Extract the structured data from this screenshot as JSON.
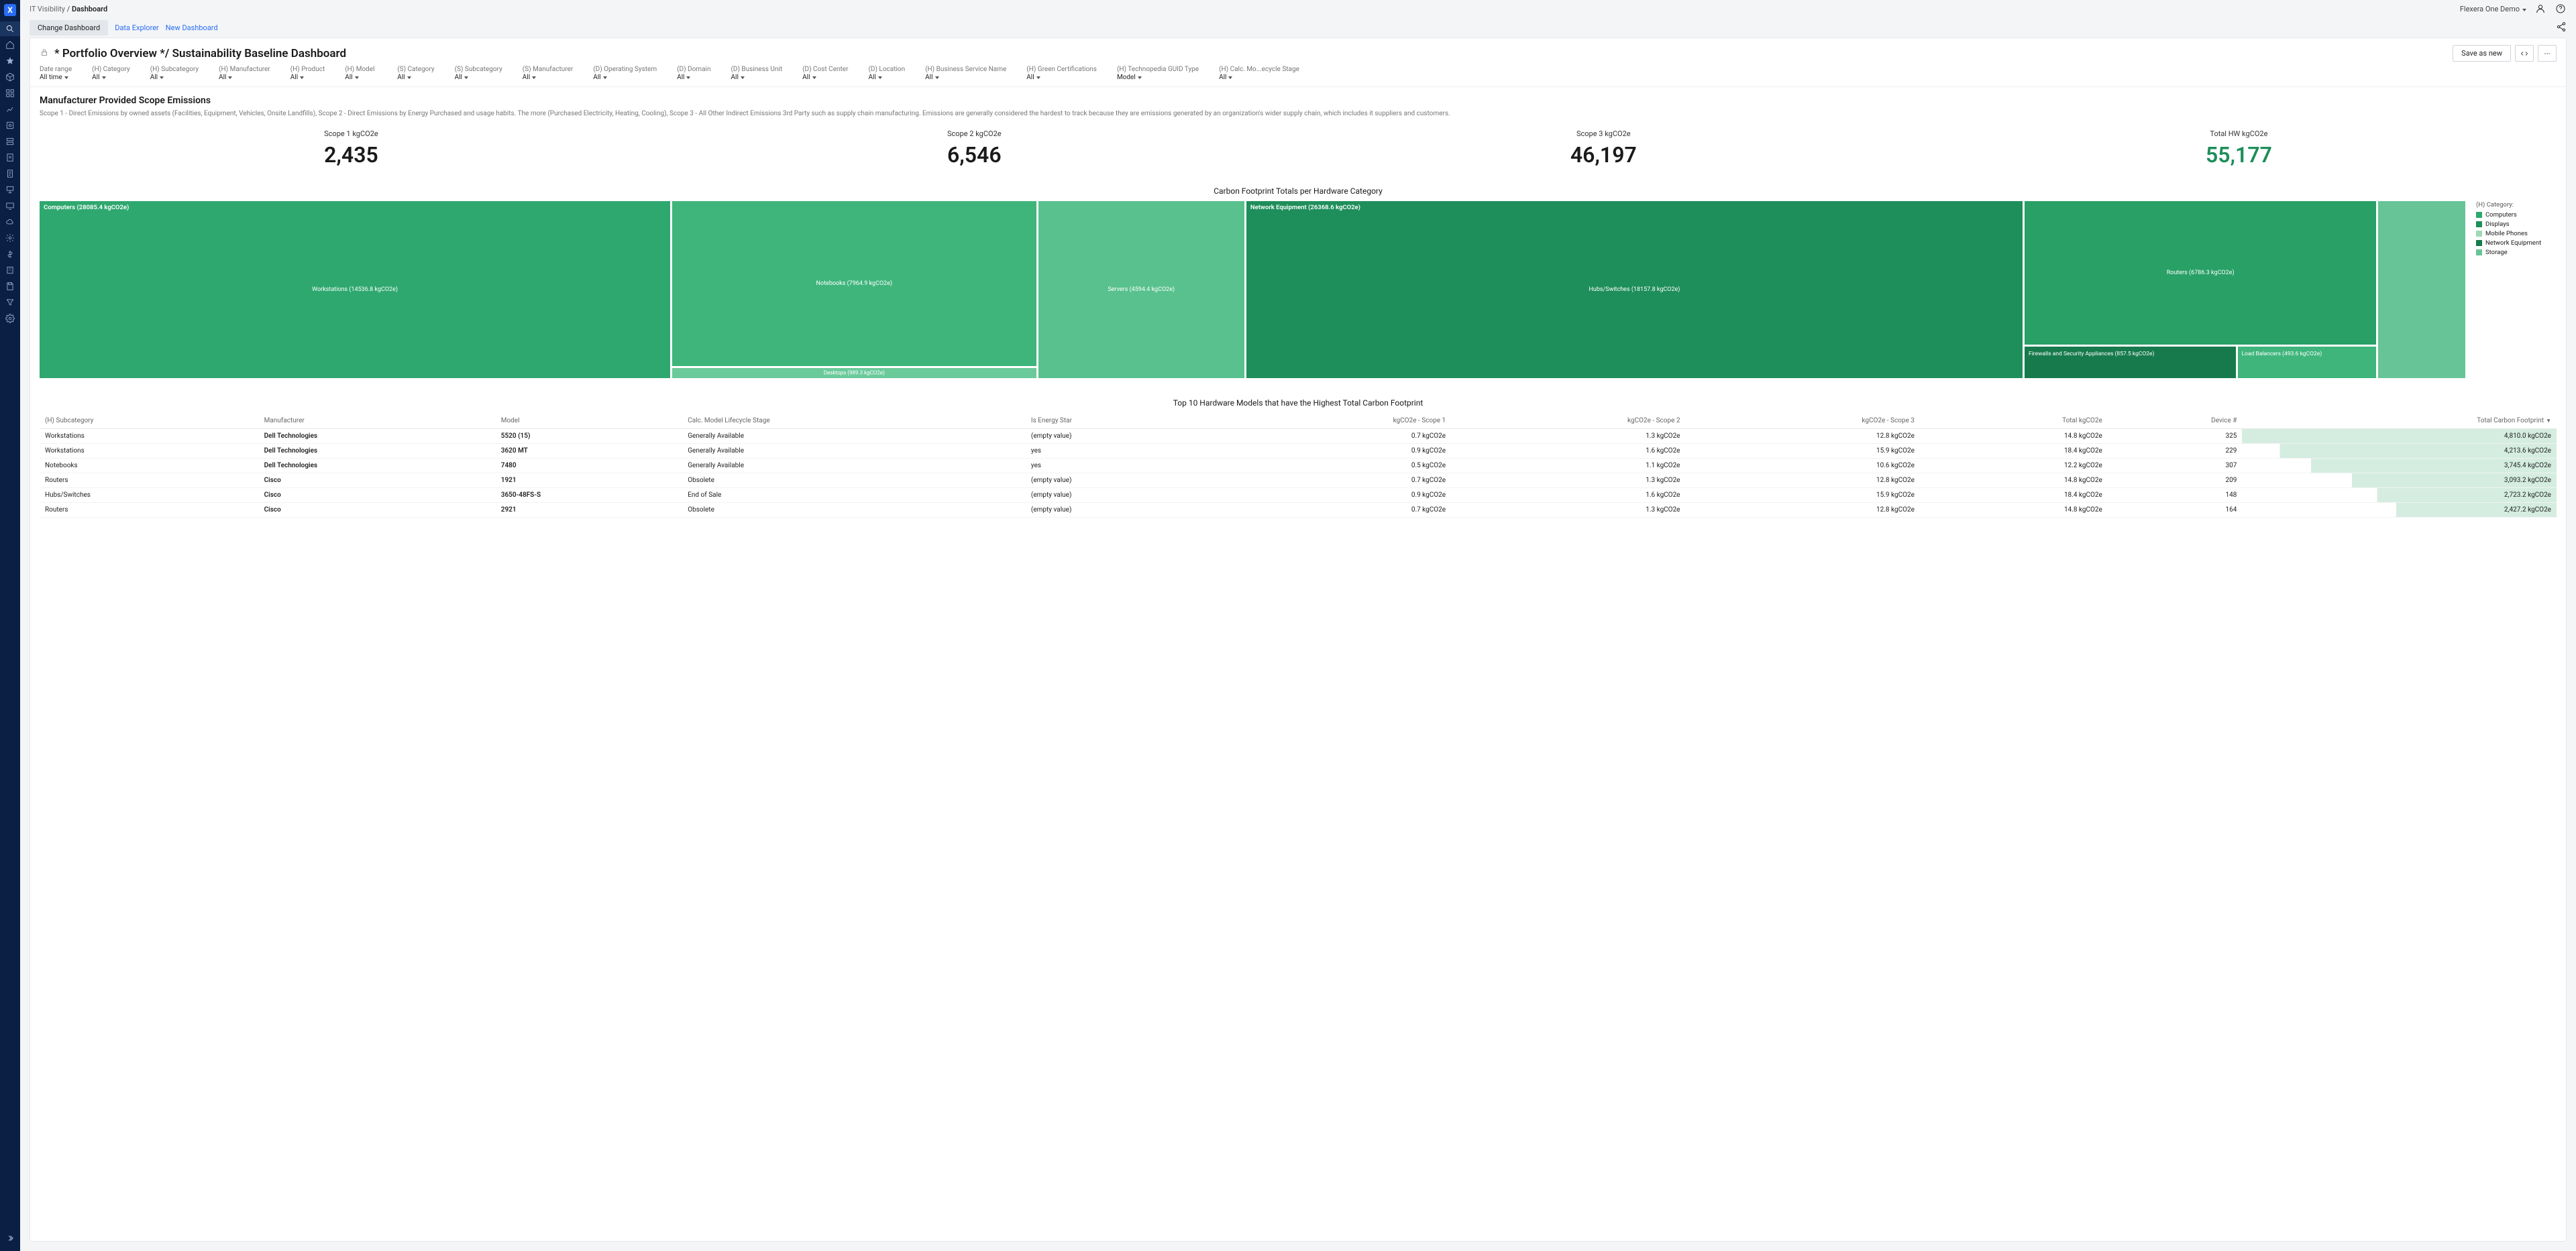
{
  "breadcrumb": {
    "parent": "IT Visibility",
    "current": "Dashboard"
  },
  "tenant": "Flexera One Demo",
  "secbar": {
    "change": "Change Dashboard",
    "explorer": "Data Explorer",
    "new": "New Dashboard"
  },
  "panel": {
    "title": "* Portfolio Overview */ Sustainability Baseline Dashboard",
    "save": "Save as new"
  },
  "filters": [
    {
      "label": "Date range",
      "value": "All time"
    },
    {
      "label": "(H) Category",
      "value": "All"
    },
    {
      "label": "(H) Subcategory",
      "value": "All"
    },
    {
      "label": "(H) Manufacturer",
      "value": "All"
    },
    {
      "label": "(H) Product",
      "value": "All"
    },
    {
      "label": "(H) Model",
      "value": "All"
    },
    {
      "label": "(S) Category",
      "value": "All"
    },
    {
      "label": "(S) Subcategory",
      "value": "All"
    },
    {
      "label": "(S) Manufacturer",
      "value": "All"
    },
    {
      "label": "(D) Operating System",
      "value": "All"
    },
    {
      "label": "(D) Domain",
      "value": "All"
    },
    {
      "label": "(D) Business Unit",
      "value": "All"
    },
    {
      "label": "(D) Cost Center",
      "value": "All"
    },
    {
      "label": "(D) Location",
      "value": "All"
    },
    {
      "label": "(H) Business Service Name",
      "value": "All"
    },
    {
      "label": "(H) Green Certifications",
      "value": "All"
    },
    {
      "label": "(H) Technopedia GUID Type",
      "value": "Model"
    },
    {
      "label": "(H) Calc. Mo...ecycle Stage",
      "value": "All"
    }
  ],
  "section": {
    "title": "Manufacturer Provided Scope Emissions",
    "desc": "Scope 1 - Direct Emissions by owned assets (Facilities, Equipment, Vehicles, Onsite Landfills), Scope 2 - Direct Emissions by Energy Purchased and usage habits. The more (Purchased Electricity, Heating, Cooling), Scope 3 - All Other Indirect Emissions 3rd Party such as supply chain manufacturing. Emissions are generally considered the hardest to track because they are emissions generated by an organization's wider supply chain, which includes it suppliers and customers."
  },
  "metrics": [
    {
      "label": "Scope 1 kgCO2e",
      "value": "2,435"
    },
    {
      "label": "Scope 2 kgCO2e",
      "value": "6,546"
    },
    {
      "label": "Scope 3 kgCO2e",
      "value": "46,197"
    },
    {
      "label": "Total HW kgCO2e",
      "value": "55,177"
    }
  ],
  "chart_data": {
    "type": "treemap",
    "title": "Carbon Footprint Totals per Hardware Category",
    "unit": "kgCO2e",
    "legend_title": "(H) Category:",
    "categories": [
      {
        "name": "Computers",
        "color": "#2ea86f"
      },
      {
        "name": "Displays",
        "color": "#1e8e5a"
      },
      {
        "name": "Mobile Phones",
        "color": "#9fd9b8"
      },
      {
        "name": "Network Equipment",
        "color": "#177a4c"
      },
      {
        "name": "Storage",
        "color": "#67c497"
      }
    ],
    "groups": [
      {
        "name": "Computers",
        "value": 28085.4,
        "color": "#2ea86f",
        "children": [
          {
            "name": "Workstations",
            "value": 14536.8,
            "color": "#2ea86f"
          },
          {
            "name": "Notebooks",
            "value": 7964.9,
            "color": "#3fb57c"
          },
          {
            "name": "Servers",
            "value": 4594.4,
            "color": "#58c18d"
          },
          {
            "name": "Desktops",
            "value": 989.3,
            "color": "#6bca9a"
          }
        ]
      },
      {
        "name": "Network Equipment",
        "value": 26368.6,
        "color": "#177a4c",
        "children": [
          {
            "name": "Hubs/Switches",
            "value": 18157.8,
            "color": "#1e8e5a"
          },
          {
            "name": "Routers",
            "value": 6786.3,
            "color": "#28a066"
          },
          {
            "name": "Firewalls and Security Appliances",
            "value": 857.5,
            "color": "#177a4c"
          },
          {
            "name": "Load Balancers",
            "value": 493.6,
            "color": "#3fb57c"
          }
        ]
      }
    ]
  },
  "table": {
    "title": "Top 10 Hardware Models that have the Highest Total Carbon Footprint",
    "columns": [
      "(H) Subcategory",
      "Manufacturer",
      "Model",
      "Calc. Model Lifecycle Stage",
      "Is Energy Star",
      "kgCO2e - Scope 1",
      "kgCO2e - Scope 2",
      "kgCO2e - Scope 3",
      "Total kgCO2e",
      "Device #",
      "Total Carbon Footprint"
    ],
    "rows": [
      {
        "c0": "Workstations",
        "c1": "Dell Technologies",
        "c2": "5520 (15)",
        "c3": "Generally Available",
        "c4": "(empty value)",
        "c5": "0.7 kgCO2e",
        "c6": "1.3 kgCO2e",
        "c7": "12.8 kgCO2e",
        "c8": "14.8 kgCO2e",
        "c9": "325",
        "c10": "4,810.0 kgCO2e",
        "p": "0%"
      },
      {
        "c0": "Workstations",
        "c1": "Dell Technologies",
        "c2": "3620 MT",
        "c3": "Generally Available",
        "c4": "yes",
        "c5": "0.9 kgCO2e",
        "c6": "1.6 kgCO2e",
        "c7": "15.9 kgCO2e",
        "c8": "18.4 kgCO2e",
        "c9": "229",
        "c10": "4,213.6 kgCO2e",
        "p": "12%"
      },
      {
        "c0": "Notebooks",
        "c1": "Dell Technologies",
        "c2": "7480",
        "c3": "Generally Available",
        "c4": "yes",
        "c5": "0.5 kgCO2e",
        "c6": "1.1 kgCO2e",
        "c7": "10.6 kgCO2e",
        "c8": "12.2 kgCO2e",
        "c9": "307",
        "c10": "3,745.4 kgCO2e",
        "p": "22%"
      },
      {
        "c0": "Routers",
        "c1": "Cisco",
        "c2": "1921",
        "c3": "Obsolete",
        "c4": "(empty value)",
        "c5": "0.7 kgCO2e",
        "c6": "1.3 kgCO2e",
        "c7": "12.8 kgCO2e",
        "c8": "14.8 kgCO2e",
        "c9": "209",
        "c10": "3,093.2 kgCO2e",
        "p": "35%"
      },
      {
        "c0": "Hubs/Switches",
        "c1": "Cisco",
        "c2": "3650-48FS-S",
        "c3": "End of Sale",
        "c4": "(empty value)",
        "c5": "0.9 kgCO2e",
        "c6": "1.6 kgCO2e",
        "c7": "15.9 kgCO2e",
        "c8": "18.4 kgCO2e",
        "c9": "148",
        "c10": "2,723.2 kgCO2e",
        "p": "43%"
      },
      {
        "c0": "Routers",
        "c1": "Cisco",
        "c2": "2921",
        "c3": "Obsolete",
        "c4": "(empty value)",
        "c5": "0.7 kgCO2e",
        "c6": "1.3 kgCO2e",
        "c7": "12.8 kgCO2e",
        "c8": "14.8 kgCO2e",
        "c9": "164",
        "c10": "2,427.2 kgCO2e",
        "p": "49%"
      }
    ]
  }
}
